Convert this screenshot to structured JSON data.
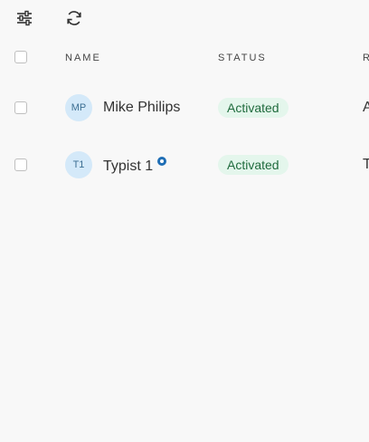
{
  "toolbar": {
    "filter_icon": "sliders-icon",
    "refresh_icon": "refresh-icon"
  },
  "table": {
    "columns": [
      "NAME",
      "STATUS",
      "R"
    ],
    "rows": [
      {
        "initials": "MP",
        "name": "Mike Philips",
        "status": "Activated",
        "role": "A"
      },
      {
        "initials": "T1",
        "name": "Typist 1",
        "status": "Activated",
        "role": "T"
      }
    ]
  },
  "colors": {
    "status_bg": "#e4f6ec",
    "status_text": "#1f6b3d",
    "avatar_bg": "#d4e9f9",
    "badge": "#1f6eb5"
  }
}
